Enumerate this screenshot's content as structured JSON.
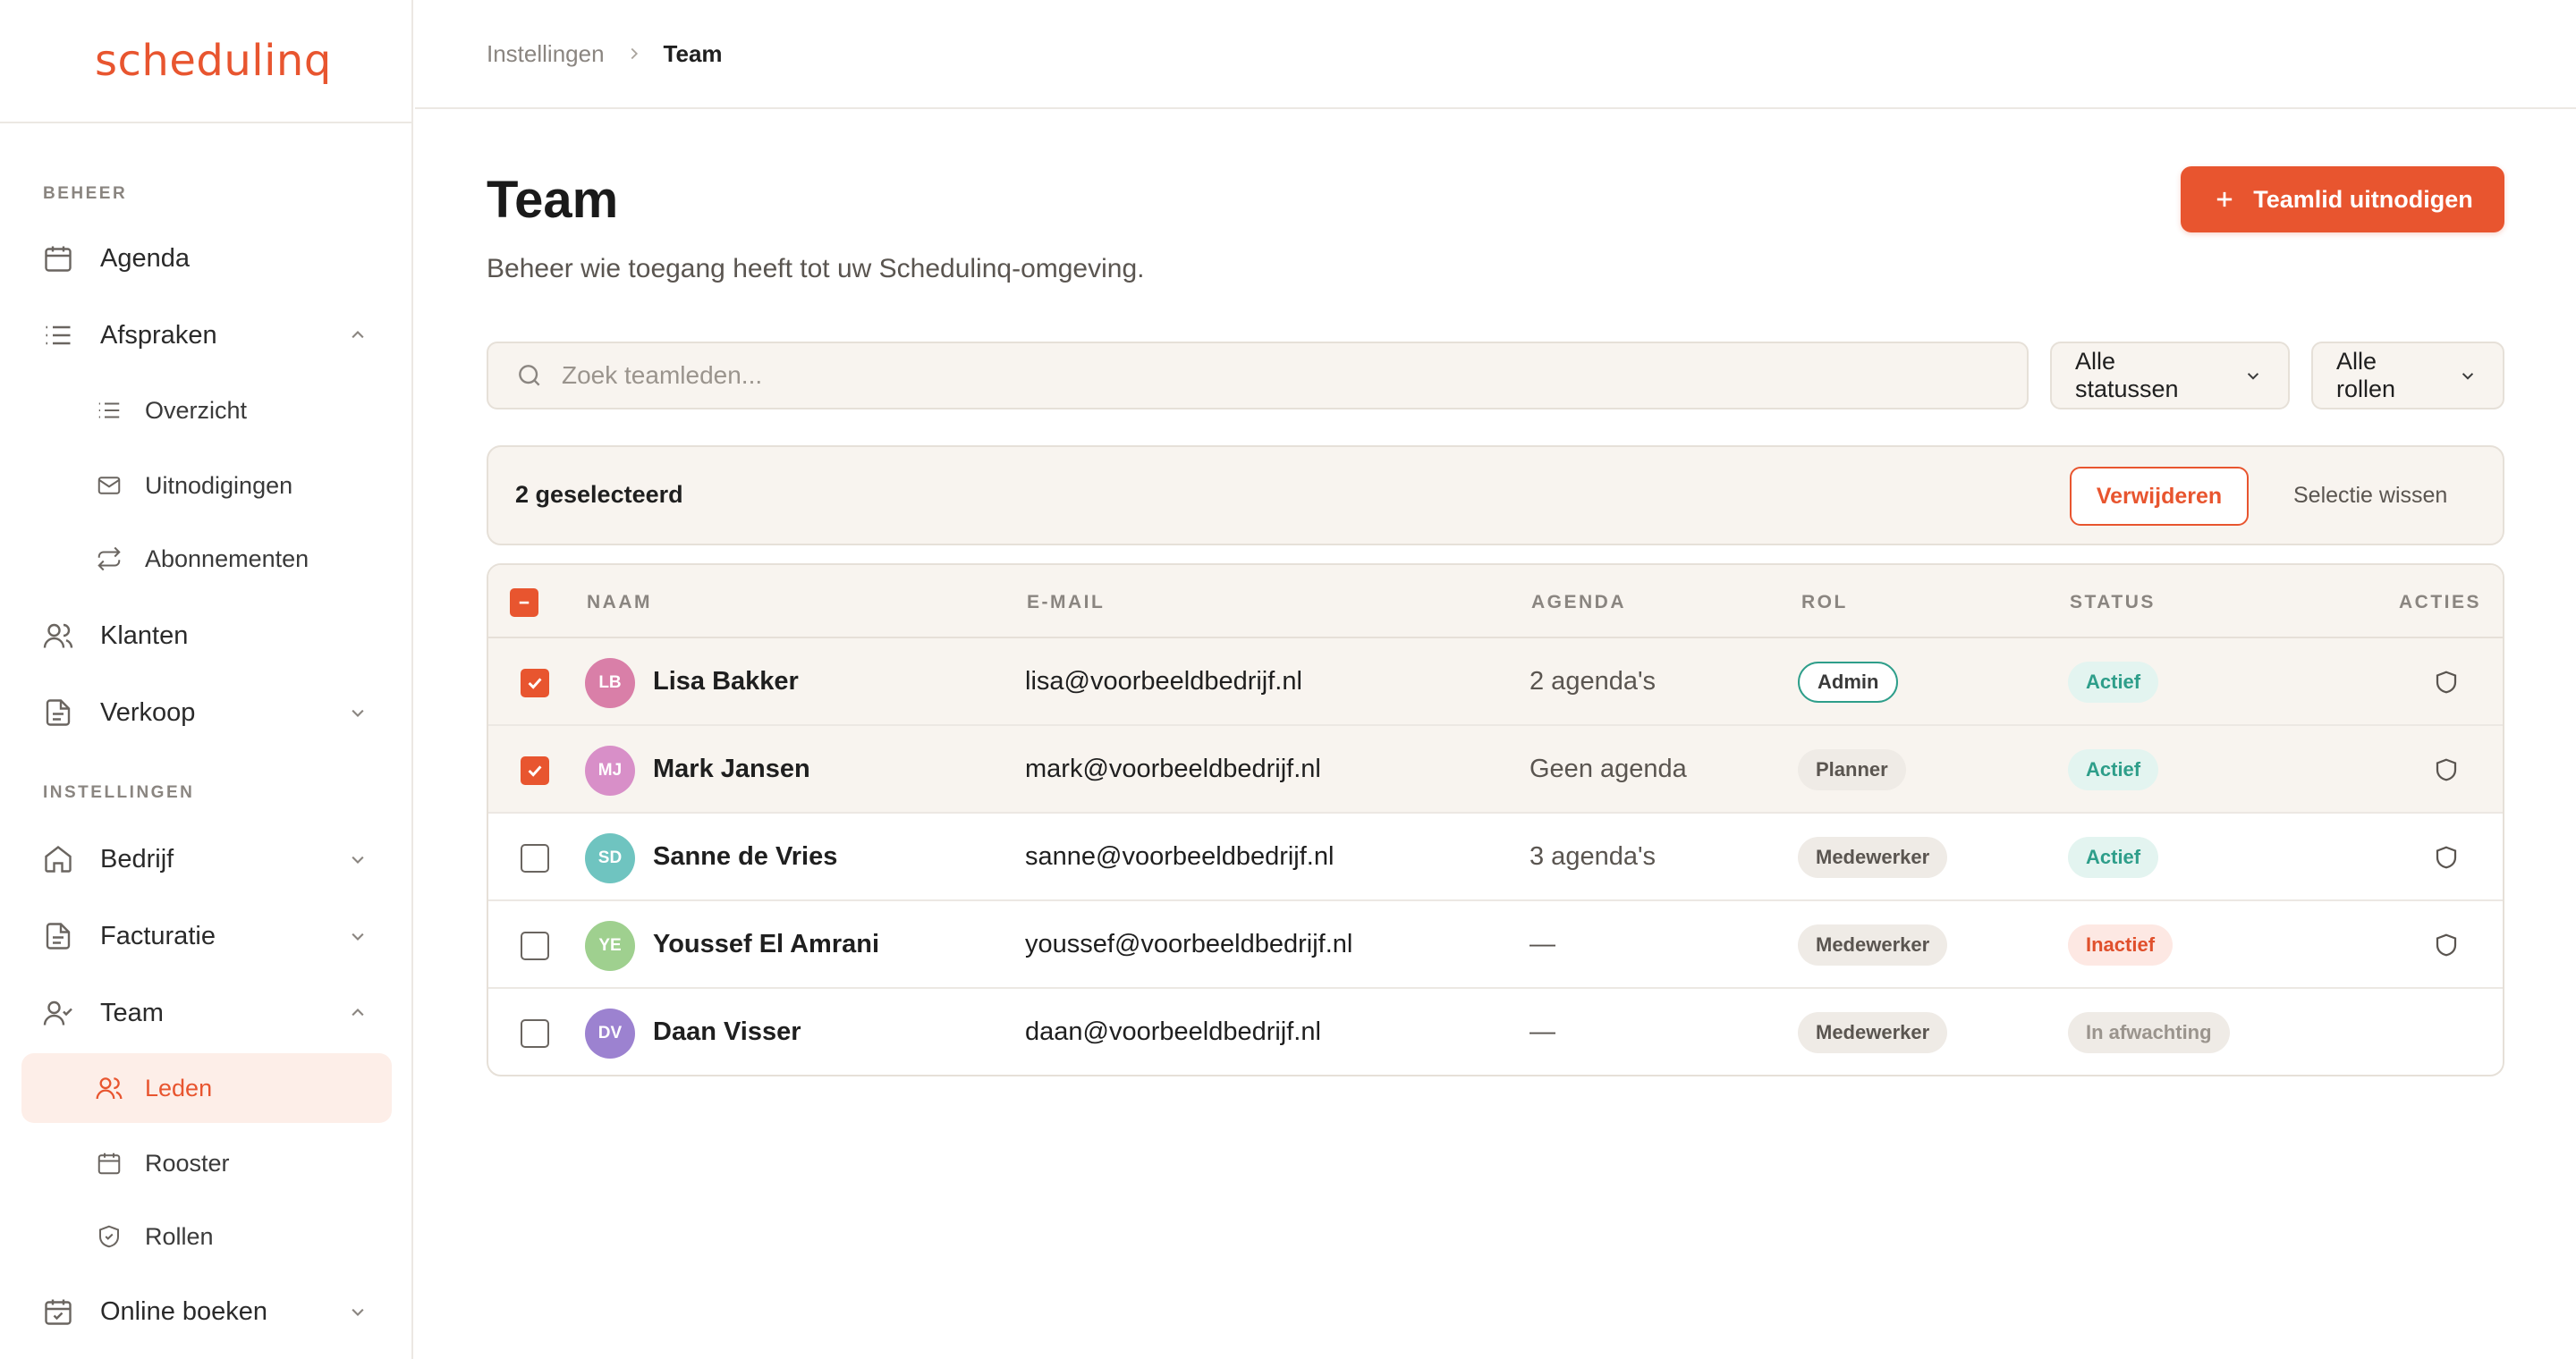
{
  "app": {
    "logo": "schedulinq"
  },
  "sidebar": {
    "sections": {
      "beheer": "BEHEER",
      "instellingen": "INSTELLINGEN"
    },
    "items": {
      "agenda": "Agenda",
      "afspraken": "Afspraken",
      "overzicht": "Overzicht",
      "uitnodigingen": "Uitnodigingen",
      "abonnementen": "Abonnementen",
      "klanten": "Klanten",
      "verkoop": "Verkoop",
      "bedrijf": "Bedrijf",
      "facturatie": "Facturatie",
      "team": "Team",
      "leden": "Leden",
      "rooster": "Rooster",
      "rollen": "Rollen",
      "online_boeken": "Online boeken"
    },
    "active_item": "leden"
  },
  "breadcrumb": {
    "parent": "Instellingen",
    "current": "Team"
  },
  "page": {
    "title": "Team",
    "subtitle": "Beheer wie toegang heeft tot uw Schedulinq-omgeving.",
    "invite_label": "Teamlid uitnodigen"
  },
  "search": {
    "placeholder": "Zoek teamleden..."
  },
  "filters": {
    "status": "Alle statussen",
    "role": "Alle rollen"
  },
  "selection": {
    "count_label": "2 geselecteerd",
    "delete_label": "Verwijderen",
    "clear_label": "Selectie wissen"
  },
  "table": {
    "headers": {
      "name": "NAAM",
      "email": "E-MAIL",
      "agenda": "AGENDA",
      "role": "ROL",
      "status": "STATUS",
      "actions": "ACTIES"
    },
    "rows": [
      {
        "initials": "LB",
        "name": "Lisa Bakker",
        "email": "lisa@voorbeeldbedrijf.nl",
        "agenda": "2 agenda's",
        "role": "Admin",
        "status": "Actief",
        "selected": true,
        "avatar_color": "#d97fa8"
      },
      {
        "initials": "MJ",
        "name": "Mark Jansen",
        "email": "mark@voorbeeldbedrijf.nl",
        "agenda": "Geen agenda",
        "role": "Planner",
        "status": "Actief",
        "selected": true,
        "avatar_color": "#d88fc8"
      },
      {
        "initials": "SD",
        "name": "Sanne de Vries",
        "email": "sanne@voorbeeldbedrijf.nl",
        "agenda": "3 agenda's",
        "role": "Medewerker",
        "status": "Actief",
        "selected": false,
        "avatar_color": "#6fc4c0"
      },
      {
        "initials": "YE",
        "name": "Youssef El Amrani",
        "email": "youssef@voorbeeldbedrijf.nl",
        "agenda": "—",
        "role": "Medewerker",
        "status": "Inactief",
        "selected": false,
        "avatar_color": "#9fd08f"
      },
      {
        "initials": "DV",
        "name": "Daan Visser",
        "email": "daan@voorbeeldbedrijf.nl",
        "agenda": "—",
        "role": "Medewerker",
        "status": "In afwachting",
        "selected": false,
        "avatar_color": "#9c82d0"
      }
    ]
  },
  "colors": {
    "accent": "#e8552f",
    "teal": "#2e9e8a"
  }
}
